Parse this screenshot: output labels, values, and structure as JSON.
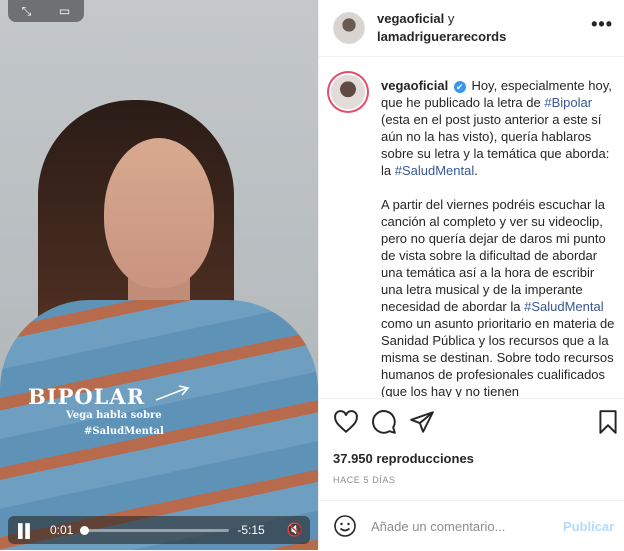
{
  "colors": {
    "accent": "#3897f0",
    "hashtag": "#385898",
    "post_disabled": "#b3dbff",
    "muted": "#8e8e8e"
  },
  "video": {
    "title_overlay": "BIPOLAR",
    "subtitle_overlay": "Vega habla sobre",
    "tag_overlay": "#SaludMental",
    "time_current": "0:01",
    "time_remaining": "-5:15",
    "progress": 0.003,
    "icons": {
      "expand": "expand-icon",
      "pip": "picture-in-picture-icon",
      "pause": "pause-icon",
      "mute": "muted-speaker-icon"
    }
  },
  "header": {
    "user1": "vegaoficial",
    "joiner": " y",
    "user2": "lamadriguerarecords",
    "more": "•••"
  },
  "caption": {
    "username": "vegaoficial",
    "verified": "✔",
    "p1_a": " Hoy, especialmente hoy, que he publicado la letra de ",
    "p1_tag1": "#Bipolar",
    "p1_b": " (esta en el post justo anterior a este sí aún no la has visto), quería hablaros sobre su letra y la temática que aborda: la ",
    "p1_tag2": "#SaludMental",
    "p1_c": ".",
    "p2_a": "A partir del viernes podréis escuchar la canción al completo y ver su videoclip, pero no quería dejar de daros mi punto de vista sobre la dificultad de abordar una temática así a la hora de escribir una letra musical y de la imperante necesidad de abordar la ",
    "p2_tag": "#SaludMental",
    "p2_b": " como un asunto prioritario en materia de Sanidad Pública y los recursos que a la misma se destinan. Sobre todo recursos humanos de profesionales cualificados (que los hay y no tienen"
  },
  "actions": {
    "icons": [
      "heart-icon",
      "comment-icon",
      "share-icon",
      "bookmark-icon"
    ]
  },
  "stats": {
    "views": "37.950 reproducciones",
    "posted": "HACE 5 DÍAS"
  },
  "comment": {
    "placeholder": "Añade un comentario...",
    "post_label": "Publicar"
  }
}
